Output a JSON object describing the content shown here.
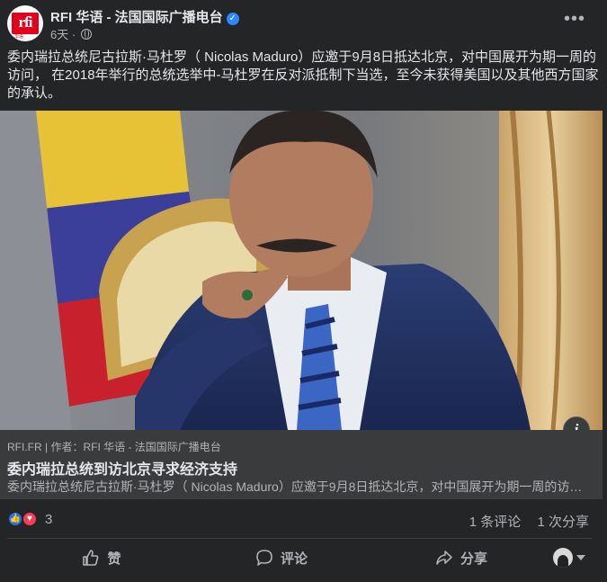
{
  "post": {
    "page_name": "RFI 华语 - 法国国际广播电台",
    "verified_mark": "✓",
    "time": "6天 ·",
    "text": "委内瑞拉总统尼古拉斯·马杜罗（ Nicolas Maduro）应邀于9月8日抵达北京，对中国展开为期一周的访问， 在2018年举行的总统选举中-马杜罗在反对派抵制下当选，至今未获得美国以及其他西方国家的承认。",
    "avatar": {
      "logo": "rfi",
      "sub": "华语"
    },
    "more_label": "•••"
  },
  "image": {
    "info_label": "i"
  },
  "link_preview": {
    "domain": "RFI.FR | 作者：RFI 华语 - 法国国际广播电台",
    "title": "委内瑞拉总统到访北京寻求经济支持",
    "description": "委内瑞拉总统尼古拉斯·马杜罗（ Nicolas Maduro）应邀于9月8日抵达北京，对中国展开为期一周的访问，"
  },
  "reactions": {
    "count": "3",
    "like_glyph": "👍",
    "love_glyph": "♥",
    "comments": "1 条评论",
    "shares": "1 次分享"
  },
  "actions": {
    "like": "赞",
    "comment": "评论",
    "share": "分享"
  },
  "colors": {
    "background": "#242526",
    "link_preview": "#3a3b3c",
    "text": "#e4e6eb",
    "secondary": "#b0b3b8",
    "like_blue": "#1877f2",
    "love_red": "#f33e58",
    "verified_blue": "#2d88ff",
    "rfi_red": "#e2001a"
  }
}
